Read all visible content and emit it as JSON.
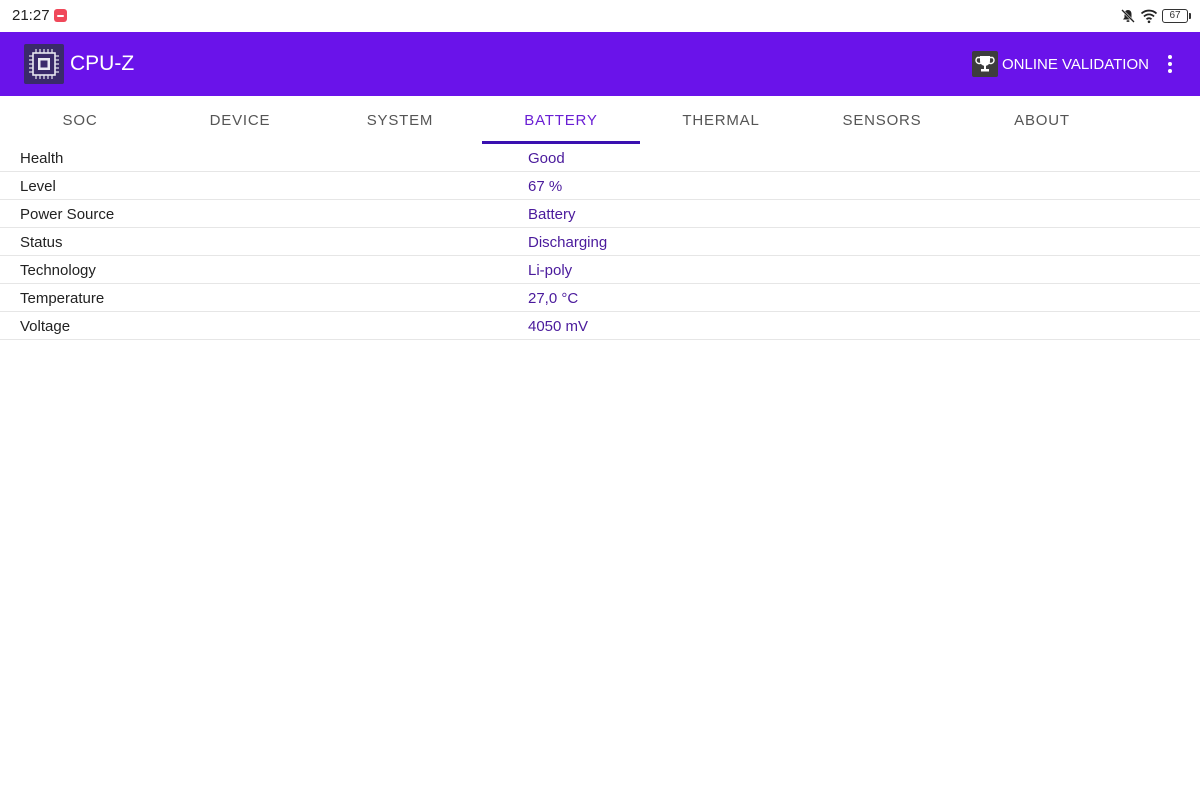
{
  "status_bar": {
    "time": "21:27",
    "battery": "67",
    "icons": [
      "screen-record-icon",
      "bell-off-icon",
      "wifi-icon",
      "battery-icon"
    ]
  },
  "app_bar": {
    "title": "CPU-Z",
    "logo_icon": "cpu-chip-icon",
    "validation_label": "ONLINE VALIDATION",
    "validation_icon": "trophy-icon",
    "menu_icon": "more-vertical-icon",
    "accent_color": "#6a13ea"
  },
  "tabs": [
    {
      "label": "SOC"
    },
    {
      "label": "DEVICE"
    },
    {
      "label": "SYSTEM"
    },
    {
      "label": "BATTERY"
    },
    {
      "label": "THERMAL"
    },
    {
      "label": "SENSORS"
    },
    {
      "label": "ABOUT"
    }
  ],
  "active_tab": "BATTERY",
  "battery_rows": [
    {
      "label": "Health",
      "value": "Good"
    },
    {
      "label": "Level",
      "value": "67 %"
    },
    {
      "label": "Power Source",
      "value": "Battery"
    },
    {
      "label": "Status",
      "value": "Discharging"
    },
    {
      "label": "Technology",
      "value": "Li-poly"
    },
    {
      "label": "Temperature",
      "value": "27,0 °C"
    },
    {
      "label": "Voltage",
      "value": "4050 mV"
    }
  ]
}
